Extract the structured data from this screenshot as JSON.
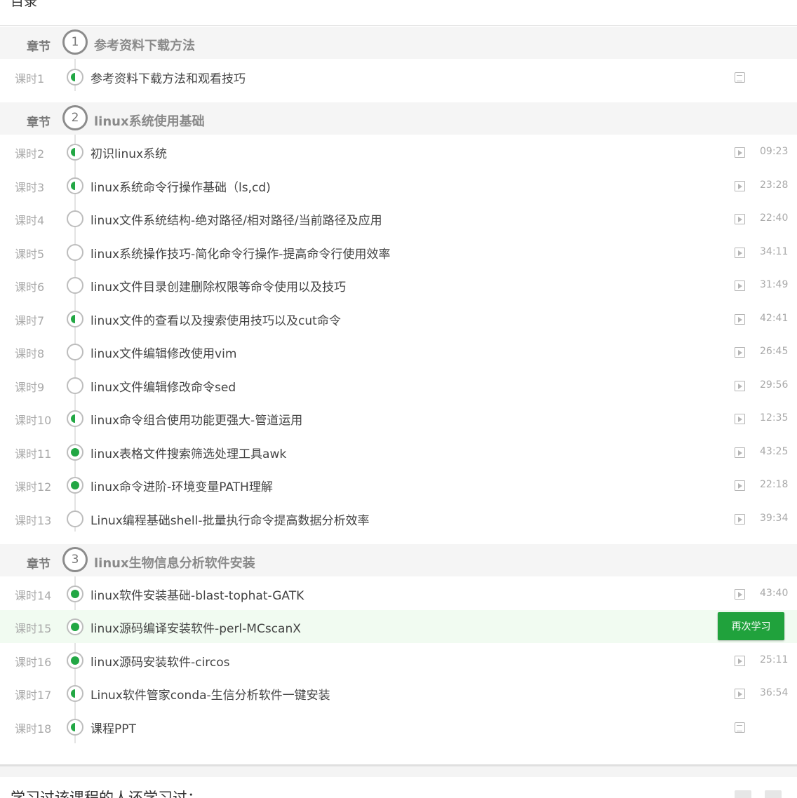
{
  "header": {
    "title": "目录"
  },
  "chapter_label": "章节",
  "chapters": [
    {
      "num": "1",
      "title": "参考资料下载方法"
    },
    {
      "num": "2",
      "title": "linux系统使用基础"
    },
    {
      "num": "3",
      "title": "linux生物信息分析软件安装"
    }
  ],
  "lessons": [
    {
      "label": "课时1",
      "title": "参考资料下载方法和观看技巧",
      "progress": "half",
      "icon": "document-icon",
      "duration": ""
    },
    {
      "label": "课时2",
      "title": "初识linux系统",
      "progress": "half",
      "icon": "play-icon",
      "duration": "09:23"
    },
    {
      "label": "课时3",
      "title": "linux系统命令行操作基础（ls,cd)",
      "progress": "half",
      "icon": "play-icon",
      "duration": "23:28"
    },
    {
      "label": "课时4",
      "title": "linux文件系统结构-绝对路径/相对路径/当前路径及应用",
      "progress": "none",
      "icon": "play-icon",
      "duration": "22:40"
    },
    {
      "label": "课时5",
      "title": "linux系统操作技巧-简化命令行操作-提高命令行使用效率",
      "progress": "none",
      "icon": "play-icon",
      "duration": "34:11"
    },
    {
      "label": "课时6",
      "title": "linux文件目录创建删除权限等命令使用以及技巧",
      "progress": "none",
      "icon": "play-icon",
      "duration": "31:49"
    },
    {
      "label": "课时7",
      "title": "linux文件的查看以及搜索使用技巧以及cut命令",
      "progress": "half",
      "icon": "play-icon",
      "duration": "42:41"
    },
    {
      "label": "课时8",
      "title": "linux文件编辑修改使用vim",
      "progress": "none",
      "icon": "play-icon",
      "duration": "26:45"
    },
    {
      "label": "课时9",
      "title": "linux文件编辑修改命令sed",
      "progress": "none",
      "icon": "play-icon",
      "duration": "29:56"
    },
    {
      "label": "课时10",
      "title": "linux命令组合使用功能更强大-管道运用",
      "progress": "half",
      "icon": "play-icon",
      "duration": "12:35"
    },
    {
      "label": "课时11",
      "title": "linux表格文件搜索筛选处理工具awk",
      "progress": "full",
      "icon": "play-icon",
      "duration": "43:25"
    },
    {
      "label": "课时12",
      "title": "linux命令进阶-环境变量PATH理解",
      "progress": "full",
      "icon": "play-icon",
      "duration": "22:18"
    },
    {
      "label": "课时13",
      "title": "Linux编程基础shell-批量执行命令提高数据分析效率",
      "progress": "none",
      "icon": "play-icon",
      "duration": "39:34"
    },
    {
      "label": "课时14",
      "title": "linux软件安装基础-blast-tophat-GATK",
      "progress": "full",
      "icon": "play-icon",
      "duration": "43:40"
    },
    {
      "label": "课时15",
      "title": "linux源码编译安装软件-perl-MCscanX",
      "progress": "full",
      "icon": "button",
      "duration": ""
    },
    {
      "label": "课时16",
      "title": "linux源码安装软件-circos",
      "progress": "full",
      "icon": "play-icon",
      "duration": "25:11"
    },
    {
      "label": "课时17",
      "title": "Linux软件管家conda-生信分析软件一键安装",
      "progress": "half",
      "icon": "play-icon",
      "duration": "36:54"
    },
    {
      "label": "课时18",
      "title": "课程PPT",
      "progress": "half",
      "icon": "document-icon",
      "duration": ""
    }
  ],
  "relearn_button": "再次学习",
  "footer": {
    "heading": "学习过该课程的人还学习过："
  }
}
